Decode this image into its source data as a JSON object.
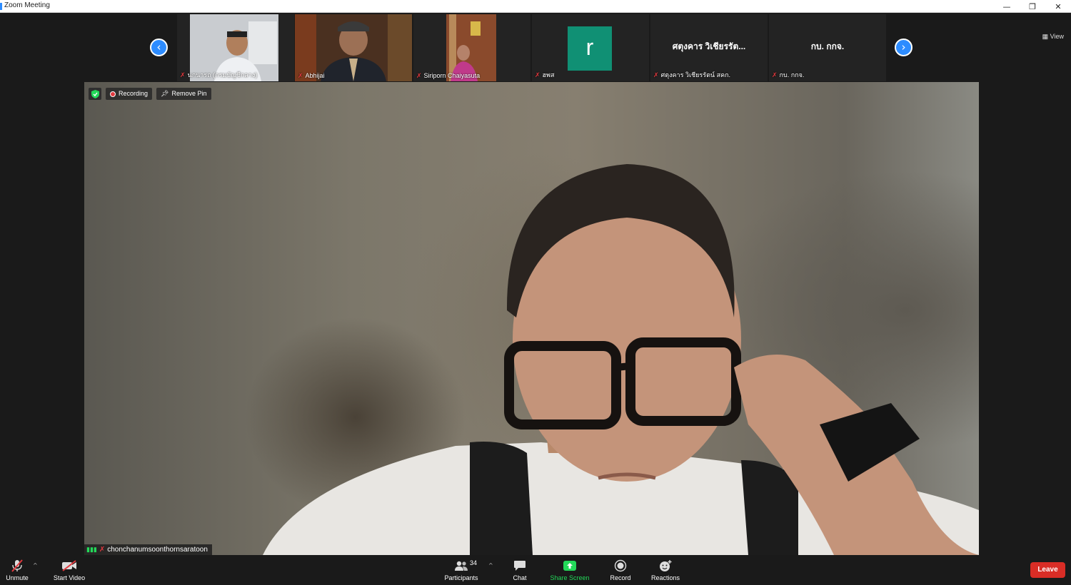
{
  "window": {
    "title": "Zoom Meeting",
    "controls": {
      "minimize": "—",
      "restore": "❐",
      "close": "✕"
    }
  },
  "gallery_strip": {
    "prev_icon": "chevron-left",
    "next_icon": "chevron-right",
    "view_label": "View",
    "tiles": [
      {
        "name": "นกนารถ (กรมบัญชีกลาง)",
        "muted": true,
        "type": "video"
      },
      {
        "name": "Abhijai",
        "muted": true,
        "type": "video"
      },
      {
        "name": "Siriporn Chaiyasuta",
        "muted": true,
        "type": "video"
      },
      {
        "name": "ฮพส",
        "muted": true,
        "type": "avatar",
        "avatar_letter": "r",
        "avatar_color": "#109074"
      },
      {
        "name": "ศตุงคาร วิเชียรรัตน์ สคก.",
        "muted": true,
        "type": "text",
        "display_text": "ศตุงคาร วิเชียรรัต..."
      },
      {
        "name": "กบ. กกจ.",
        "muted": true,
        "type": "text",
        "display_text": "กบ. กกจ."
      }
    ]
  },
  "main_video": {
    "recording_label": "Recording",
    "remove_pin_label": "Remove Pin",
    "speaker_name": "chonchanumsoonthornsaratoon"
  },
  "toolbar": {
    "unmute_label": "Unmute",
    "start_video_label": "Start Video",
    "participants_label": "Participants",
    "participants_count": "34",
    "chat_label": "Chat",
    "share_screen_label": "Share Screen",
    "record_label": "Record",
    "reactions_label": "Reactions",
    "leave_label": "Leave"
  },
  "colors": {
    "accent_blue": "#2d8cff",
    "share_green": "#23d959",
    "leave_red": "#d92d26",
    "muted_red": "#e0393e"
  }
}
